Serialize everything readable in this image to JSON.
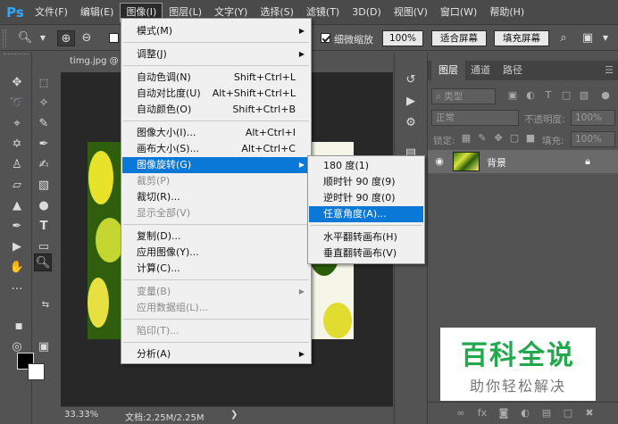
{
  "app": {
    "logo": "Ps"
  },
  "menubar": {
    "items": [
      "文件(F)",
      "编辑(E)",
      "图像(I)",
      "图层(L)",
      "文字(Y)",
      "选择(S)",
      "滤镜(T)",
      "3D(D)",
      "视图(V)",
      "窗口(W)",
      "帮助(H)"
    ],
    "active_index": 2
  },
  "options": {
    "scrubby_zoom_label": "细微缩放",
    "btn_100": "100%",
    "btn_fit": "适合屏幕",
    "btn_fill": "填充屏幕"
  },
  "document": {
    "tab_title": "timg.jpg @ 33.3%",
    "zoom": "33.33%",
    "doc_size": "文档:2.25M/2.25M"
  },
  "image_menu": {
    "items": [
      {
        "label": "模式(M)",
        "shortcut": "",
        "submenu": true,
        "disabled": false
      },
      {
        "label": "调整(J)",
        "shortcut": "",
        "submenu": true,
        "disabled": false
      },
      {
        "label": "自动色调(N)",
        "shortcut": "Shift+Ctrl+L",
        "submenu": false,
        "disabled": false
      },
      {
        "label": "自动对比度(U)",
        "shortcut": "Alt+Shift+Ctrl+L",
        "submenu": false,
        "disabled": false
      },
      {
        "label": "自动颜色(O)",
        "shortcut": "Shift+Ctrl+B",
        "submenu": false,
        "disabled": false
      },
      {
        "label": "图像大小(I)...",
        "shortcut": "Alt+Ctrl+I",
        "submenu": false,
        "disabled": false
      },
      {
        "label": "画布大小(S)...",
        "shortcut": "Alt+Ctrl+C",
        "submenu": false,
        "disabled": false
      },
      {
        "label": "图像旋转(G)",
        "shortcut": "",
        "submenu": true,
        "disabled": false
      },
      {
        "label": "裁剪(P)",
        "shortcut": "",
        "submenu": false,
        "disabled": true
      },
      {
        "label": "裁切(R)...",
        "shortcut": "",
        "submenu": false,
        "disabled": false
      },
      {
        "label": "显示全部(V)",
        "shortcut": "",
        "submenu": false,
        "disabled": true
      },
      {
        "label": "复制(D)...",
        "shortcut": "",
        "submenu": false,
        "disabled": false
      },
      {
        "label": "应用图像(Y)...",
        "shortcut": "",
        "submenu": false,
        "disabled": false
      },
      {
        "label": "计算(C)...",
        "shortcut": "",
        "submenu": false,
        "disabled": false
      },
      {
        "label": "变量(B)",
        "shortcut": "",
        "submenu": true,
        "disabled": true
      },
      {
        "label": "应用数据组(L)...",
        "shortcut": "",
        "submenu": false,
        "disabled": true
      },
      {
        "label": "陷印(T)...",
        "shortcut": "",
        "submenu": false,
        "disabled": true
      },
      {
        "label": "分析(A)",
        "shortcut": "",
        "submenu": true,
        "disabled": false
      }
    ]
  },
  "rotate_menu": {
    "items": [
      "180 度(1)",
      "顺时针 90 度(9)",
      "逆时针 90 度(0)",
      "任意角度(A)...",
      "水平翻转画布(H)",
      "垂直翻转画布(V)"
    ],
    "highlighted_index": 3
  },
  "layers_panel": {
    "tabs": [
      "图层",
      "通道",
      "路径"
    ],
    "kind_filter": "类型",
    "blend_mode": "正常",
    "opacity_label": "不透明度:",
    "opacity_value": "100%",
    "lock_label": "锁定:",
    "fill_label": "填充:",
    "fill_value": "100%",
    "layer_name": "背景"
  },
  "watermark": {
    "line1": "百科全说",
    "line2": "助你轻松解决"
  },
  "colors": {
    "highlight": "#0a78d7",
    "ps_blue": "#31a8ff",
    "watermark_green": "#23a84e"
  }
}
